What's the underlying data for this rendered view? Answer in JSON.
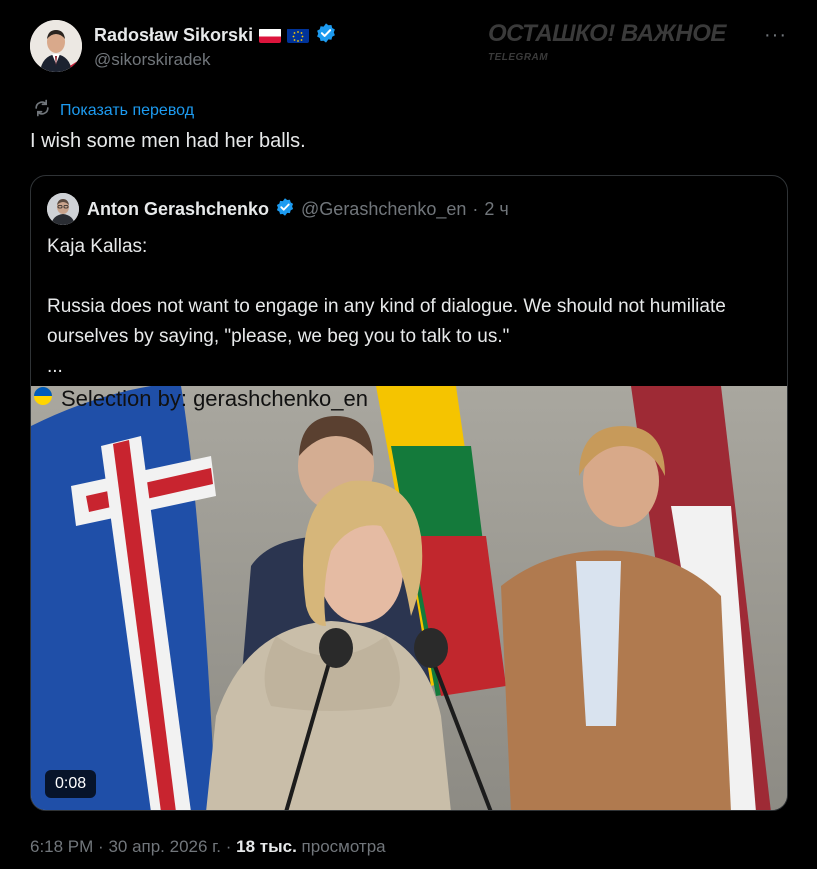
{
  "author": {
    "name": "Radosław Sikorski",
    "handle": "@sikorskiradek"
  },
  "watermark": {
    "title": "ОСТАШКО! ВАЖНОЕ",
    "subtitle": "TELEGRAM"
  },
  "more_label": "···",
  "translate_label": "Показать перевод",
  "tweet_text": "I wish some men had her balls.",
  "quote": {
    "name": "Anton Gerashchenko",
    "handle": "@Gerashchenko_en",
    "separator": "·",
    "time": "2 ч",
    "body": "Kaja Kallas:\n\nRussia does not want to engage in any kind of dialogue. We should not humiliate ourselves by saying, \"please, we beg you to talk to us.\"\n...",
    "media_overlay": "Selection by: gerashchenko_en",
    "duration": "0:08"
  },
  "footer": {
    "time": "6:18 PM",
    "date": "30 апр. 2026 г.",
    "views_count": "18 тыс.",
    "views_label": "просмотра"
  },
  "colors": {
    "background": "#000000",
    "link": "#1d9bf0",
    "muted": "#71767b",
    "verified": "#1d9bf0"
  }
}
